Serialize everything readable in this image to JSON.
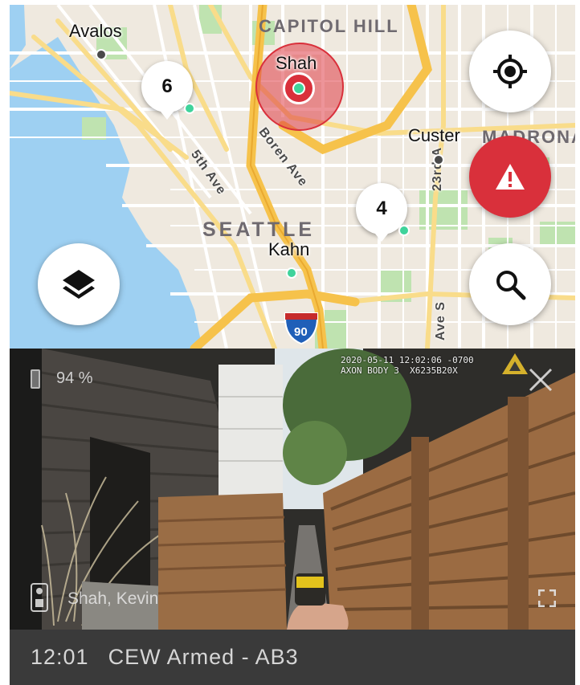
{
  "map": {
    "districts": {
      "capitol_hill": "CAPITOL HILL",
      "seattle": "SEATTLE",
      "madrona": "MADRONA"
    },
    "streets": {
      "fifth_ave": "5th Ave",
      "boren_ave": "Boren Ave",
      "twenty_third": "23rd A",
      "ave_s": "Ave S"
    },
    "highway_shield": "90",
    "officers": [
      {
        "name": "Avalos",
        "status": "offline"
      },
      {
        "name": "Shah",
        "status": "active",
        "selected": true
      },
      {
        "name": "Custer",
        "status": "offline"
      },
      {
        "name": "Kahn",
        "status": "active"
      }
    ],
    "clusters": [
      {
        "count": "6"
      },
      {
        "count": "4"
      }
    ],
    "buttons": [
      "locate-me",
      "emergency-alert",
      "map-layers",
      "search"
    ],
    "colors": {
      "accent_red": "#d9303b",
      "active_teal": "#3fd39b",
      "highway": "#f6c24b"
    }
  },
  "video": {
    "battery": "94 %",
    "timestamp": "2020-05-11 12:02:06 -0700",
    "device": "AXON BODY 3  X6235B20X",
    "officer_label": "Shah, Kevin"
  },
  "status_bar": {
    "time": "12:01",
    "event": "CEW Armed - AB3"
  }
}
